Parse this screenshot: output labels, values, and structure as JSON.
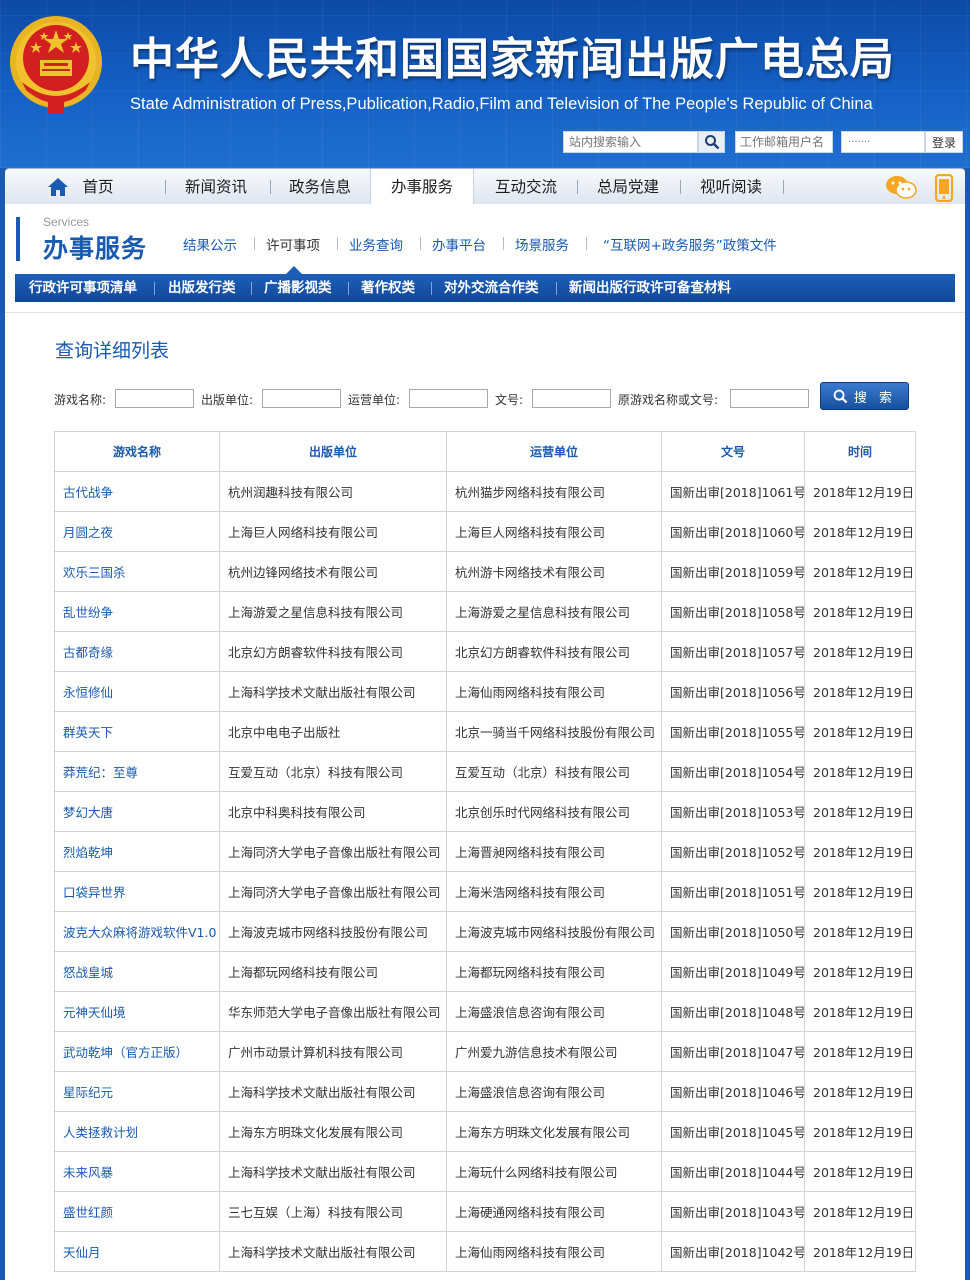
{
  "header": {
    "title_cn": "中华人民共和国国家新闻出版广电总局",
    "title_en": "State Administration of Press,Publication,Radio,Film and Television of The People's Republic of China",
    "search_placeholder": "站内搜索输入",
    "mail_placeholder": "工作邮箱用户名",
    "pwd_placeholder": "·······",
    "login_label": "登录"
  },
  "nav": {
    "items": [
      "首页",
      "新闻资讯",
      "政务信息",
      "办事服务",
      "互动交流",
      "总局党建",
      "视听阅读"
    ],
    "active": "办事服务"
  },
  "section": {
    "label_en": "Services",
    "label_cn": "办事服务",
    "sublinks": [
      "结果公示",
      "许可事项",
      "业务查询",
      "办事平台",
      "场景服务",
      "“互联网+政务服务”政策文件"
    ],
    "active_sublink": "许可事项"
  },
  "tabs": [
    "行政许可事项清单",
    "出版发行类",
    "广播影视类",
    "著作权类",
    "对外交流合作类",
    "新闻出版行政许可备查材料"
  ],
  "list": {
    "title": "查询详细列表",
    "filters": {
      "game_name": "游戏名称:",
      "publisher": "出版单位:",
      "operator": "运营单位:",
      "doc_no": "文号:",
      "original": "原游戏名称或文号:"
    },
    "search_label": "搜 索"
  },
  "table": {
    "headers": [
      "游戏名称",
      "出版单位",
      "运营单位",
      "文号",
      "时间"
    ],
    "rows": [
      [
        "古代战争",
        "杭州润趣科技有限公司",
        "杭州猫步网络科技有限公司",
        "国新出审[2018]1061号",
        "2018年12月19日"
      ],
      [
        "月圆之夜",
        "上海巨人网络科技有限公司",
        "上海巨人网络科技有限公司",
        "国新出审[2018]1060号",
        "2018年12月19日"
      ],
      [
        "欢乐三国杀",
        "杭州边锋网络技术有限公司",
        "杭州游卡网络技术有限公司",
        "国新出审[2018]1059号",
        "2018年12月19日"
      ],
      [
        "乱世纷争",
        "上海游爱之星信息科技有限公司",
        "上海游爱之星信息科技有限公司",
        "国新出审[2018]1058号",
        "2018年12月19日"
      ],
      [
        "古都奇缘",
        "北京幻方朗睿软件科技有限公司",
        "北京幻方朗睿软件科技有限公司",
        "国新出审[2018]1057号",
        "2018年12月19日"
      ],
      [
        "永恒修仙",
        "上海科学技术文献出版社有限公司",
        "上海仙雨网络科技有限公司",
        "国新出审[2018]1056号",
        "2018年12月19日"
      ],
      [
        "群英天下",
        "北京中电电子出版社",
        "北京一骑当千网络科技股份有限公司",
        "国新出审[2018]1055号",
        "2018年12月19日"
      ],
      [
        "莽荒纪：至尊",
        "互爱互动（北京）科技有限公司",
        "互爱互动（北京）科技有限公司",
        "国新出审[2018]1054号",
        "2018年12月19日"
      ],
      [
        "梦幻大唐",
        "北京中科奥科技有限公司",
        "北京创乐时代网络科技有限公司",
        "国新出审[2018]1053号",
        "2018年12月19日"
      ],
      [
        "烈焰乾坤",
        "上海同济大学电子音像出版社有限公司",
        "上海晋昶网络科技有限公司",
        "国新出审[2018]1052号",
        "2018年12月19日"
      ],
      [
        "口袋异世界",
        "上海同济大学电子音像出版社有限公司",
        "上海米浩网络科技有限公司",
        "国新出审[2018]1051号",
        "2018年12月19日"
      ],
      [
        "波克大众麻将游戏软件V1.0",
        "上海波克城市网络科技股份有限公司",
        "上海波克城市网络科技股份有限公司",
        "国新出审[2018]1050号",
        "2018年12月19日"
      ],
      [
        "怒战皇城",
        "上海都玩网络科技有限公司",
        "上海都玩网络科技有限公司",
        "国新出审[2018]1049号",
        "2018年12月19日"
      ],
      [
        "元神天仙境",
        "华东师范大学电子音像出版社有限公司",
        "上海盛浪信息咨询有限公司",
        "国新出审[2018]1048号",
        "2018年12月19日"
      ],
      [
        "武动乾坤（官方正版）",
        "广州市动景计算机科技有限公司",
        "广州爱九游信息技术有限公司",
        "国新出审[2018]1047号",
        "2018年12月19日"
      ],
      [
        "星际纪元",
        "上海科学技术文献出版社有限公司",
        "上海盛浪信息咨询有限公司",
        "国新出审[2018]1046号",
        "2018年12月19日"
      ],
      [
        "人类拯救计划",
        "上海东方明珠文化发展有限公司",
        "上海东方明珠文化发展有限公司",
        "国新出审[2018]1045号",
        "2018年12月19日"
      ],
      [
        "未来风暴",
        "上海科学技术文献出版社有限公司",
        "上海玩什么网络科技有限公司",
        "国新出审[2018]1044号",
        "2018年12月19日"
      ],
      [
        "盛世红颜",
        "三七互娱（上海）科技有限公司",
        "上海硬通网络科技有限公司",
        "国新出审[2018]1043号",
        "2018年12月19日"
      ],
      [
        "天仙月",
        "上海科学技术文献出版社有限公司",
        "上海仙雨网络科技有限公司",
        "国新出审[2018]1042号",
        "2018年12月19日"
      ]
    ]
  },
  "colors": {
    "brand_blue": "#1a5ab0",
    "banner_top": "#0d4aa6",
    "emblem_red": "#d21f1f",
    "emblem_gold": "#f2c12e"
  }
}
